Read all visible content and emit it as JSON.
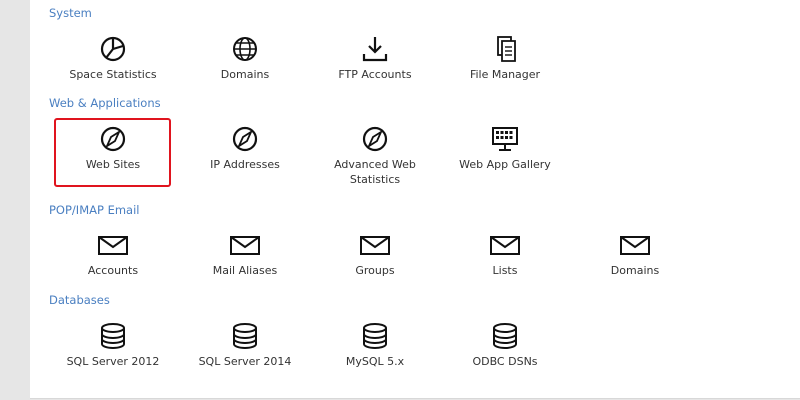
{
  "sections": {
    "system": {
      "title": "System",
      "items": [
        "Space Statistics",
        "Domains",
        "FTP Accounts",
        "File Manager"
      ]
    },
    "web": {
      "title": "Web & Applications",
      "items": [
        "Web Sites",
        "IP Addresses",
        "Advanced Web Statistics",
        "Web App Gallery"
      ]
    },
    "mail": {
      "title": "POP/IMAP Email",
      "items": [
        "Accounts",
        "Mail Aliases",
        "Groups",
        "Lists",
        "Domains"
      ]
    },
    "databases": {
      "title": "Databases",
      "items": [
        "SQL Server 2012",
        "SQL Server 2014",
        "MySQL 5.x",
        "ODBC DSNs"
      ]
    }
  },
  "icons": {
    "space_statistics": "pie-chart-icon",
    "domains": "globe-icon",
    "ftp_accounts": "download-icon",
    "file_manager": "document-icon",
    "web_sites": "compass-icon",
    "ip_addresses": "compass-icon",
    "advanced_web_statistics": "compass-icon",
    "web_app_gallery": "monitor-grid-icon",
    "mail": "envelope-icon",
    "databases": "database-icon"
  },
  "colors": {
    "section_title": "#4a7fc1",
    "highlight": "#e0141e",
    "text": "#333333"
  }
}
